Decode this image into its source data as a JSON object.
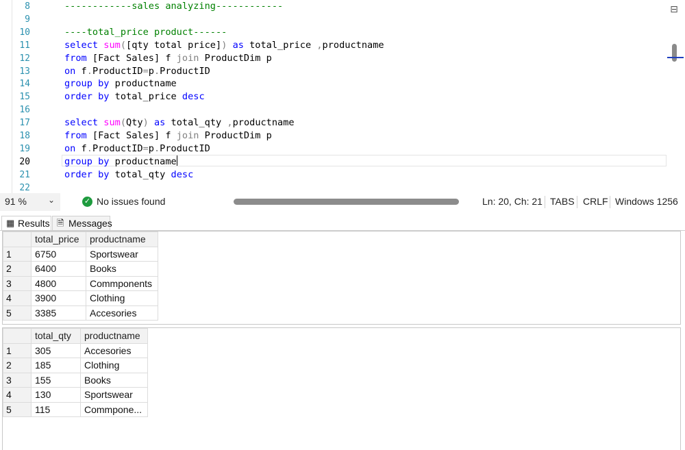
{
  "editor": {
    "lines": [
      {
        "num": "8",
        "html": "<span class=\"cm\">------------sales analyzing------------</span>"
      },
      {
        "num": "9",
        "html": ""
      },
      {
        "num": "10",
        "html": "<span class=\"cm\">----total_price product------</span>"
      },
      {
        "num": "11",
        "html": "<span class=\"kw\">select</span> <span class=\"fn\">sum</span><span class=\"gr\">(</span>[qty total price]<span class=\"gr\">)</span> <span class=\"kw\">as</span> total_price <span class=\"gr\">,</span>productname"
      },
      {
        "num": "12",
        "html": "<span class=\"kw\">from</span> [Fact Sales] f <span class=\"gr\">join</span> ProductDim p"
      },
      {
        "num": "13",
        "html": "<span class=\"kw\">on</span> f<span class=\"gr\">.</span>ProductID<span class=\"gr\">=</span>p<span class=\"gr\">.</span>ProductID"
      },
      {
        "num": "14",
        "html": "<span class=\"kw\">group by</span> productname"
      },
      {
        "num": "15",
        "html": "<span class=\"kw\">order by</span> total_price <span class=\"kw\">desc</span>"
      },
      {
        "num": "16",
        "html": ""
      },
      {
        "num": "17",
        "html": "<span class=\"kw\">select</span> <span class=\"fn\">sum</span><span class=\"gr\">(</span>Qty<span class=\"gr\">)</span> <span class=\"kw\">as</span> total_qty <span class=\"gr\">,</span>productname"
      },
      {
        "num": "18",
        "html": "<span class=\"kw\">from</span> [Fact Sales] f <span class=\"gr\">join</span> ProductDim p"
      },
      {
        "num": "19",
        "html": "<span class=\"kw\">on</span> f<span class=\"gr\">.</span>ProductID<span class=\"gr\">=</span>p<span class=\"gr\">.</span>ProductID"
      },
      {
        "num": "20",
        "html": "<span class=\"kw\">group by</span> productname<span class=\"caret\"></span>",
        "current": true
      },
      {
        "num": "21",
        "html": "<span class=\"kw\">order by</span> total_qty <span class=\"kw\">desc</span>"
      },
      {
        "num": "22",
        "html": ""
      }
    ]
  },
  "status": {
    "zoom": "91 %",
    "issues": "No issues found",
    "position": "Ln: 20, Ch: 21",
    "tabs": "TABS",
    "line_ending": "CRLF",
    "encoding": "Windows 1256",
    "ok_color": "#1e9b3e"
  },
  "tabs": {
    "results": "Results",
    "messages": "Messages",
    "results_icon": "grid-icon",
    "messages_icon": "messages-icon"
  },
  "grid1": {
    "columns": [
      "total_price",
      "productname"
    ],
    "rows": [
      [
        "1",
        "6750",
        "Sportswear"
      ],
      [
        "2",
        "6400",
        "Books"
      ],
      [
        "3",
        "4800",
        "Commponents"
      ],
      [
        "4",
        "3900",
        "Clothing"
      ],
      [
        "5",
        "3385",
        "Accesories"
      ]
    ]
  },
  "grid2": {
    "columns": [
      "total_qty",
      "productname"
    ],
    "rows": [
      [
        "1",
        "305",
        "Accesories"
      ],
      [
        "2",
        "185",
        "Clothing"
      ],
      [
        "3",
        "155",
        "Books"
      ],
      [
        "4",
        "130",
        "Sportswear"
      ],
      [
        "5",
        "115",
        "Commpone..."
      ]
    ]
  }
}
